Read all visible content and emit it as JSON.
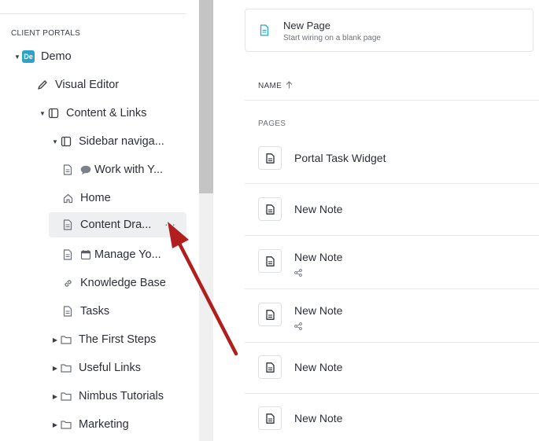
{
  "sidebar": {
    "section_title": "CLIENT PORTALS",
    "items": [
      {
        "label": "Demo",
        "icon": "workspace-badge",
        "badge_text": "De",
        "expanded": true
      },
      {
        "label": "Visual Editor",
        "icon": "pencil-icon"
      },
      {
        "label": "Content & Links",
        "icon": "sidebar-layout-icon",
        "expanded": true
      },
      {
        "label": "Sidebar naviga...",
        "icon": "sidebar-layout-icon",
        "expanded": true
      },
      {
        "label": "Work with Y...",
        "icon": "document-icon",
        "emoji": "speech-bubble-icon"
      },
      {
        "label": "Home",
        "icon": "home-icon"
      },
      {
        "label": "Content Dra...",
        "icon": "document-icon",
        "selected": true,
        "menu": "···"
      },
      {
        "label": "Manage Yo...",
        "icon": "document-icon",
        "emoji": "calendar-icon"
      },
      {
        "label": "Knowledge Base",
        "icon": "link-icon"
      },
      {
        "label": "Tasks",
        "icon": "document-icon"
      },
      {
        "label": "The First Steps",
        "icon": "folder-icon",
        "expanded": false
      },
      {
        "label": "Useful Links",
        "icon": "folder-icon",
        "expanded": false
      },
      {
        "label": "Nimbus Tutorials",
        "icon": "folder-icon",
        "expanded": false
      },
      {
        "label": "Marketing",
        "icon": "folder-icon",
        "expanded": false
      }
    ]
  },
  "main": {
    "new_page": {
      "title": "New Page",
      "subtitle": "Start wiring on a blank page"
    },
    "column_header": "NAME",
    "sort_icon": "arrow-up-icon",
    "group_label": "PAGES",
    "rows": [
      {
        "title": "Portal Task Widget",
        "shared": false
      },
      {
        "title": "New Note",
        "shared": false
      },
      {
        "title": "New Note",
        "shared": true
      },
      {
        "title": "New Note",
        "shared": true
      },
      {
        "title": "New Note",
        "shared": false
      },
      {
        "title": "New Note",
        "shared": false
      }
    ]
  },
  "colors": {
    "accent": "#2aa3c7",
    "arrow": "#b01e1e",
    "selected_bg": "#eeeff1"
  }
}
